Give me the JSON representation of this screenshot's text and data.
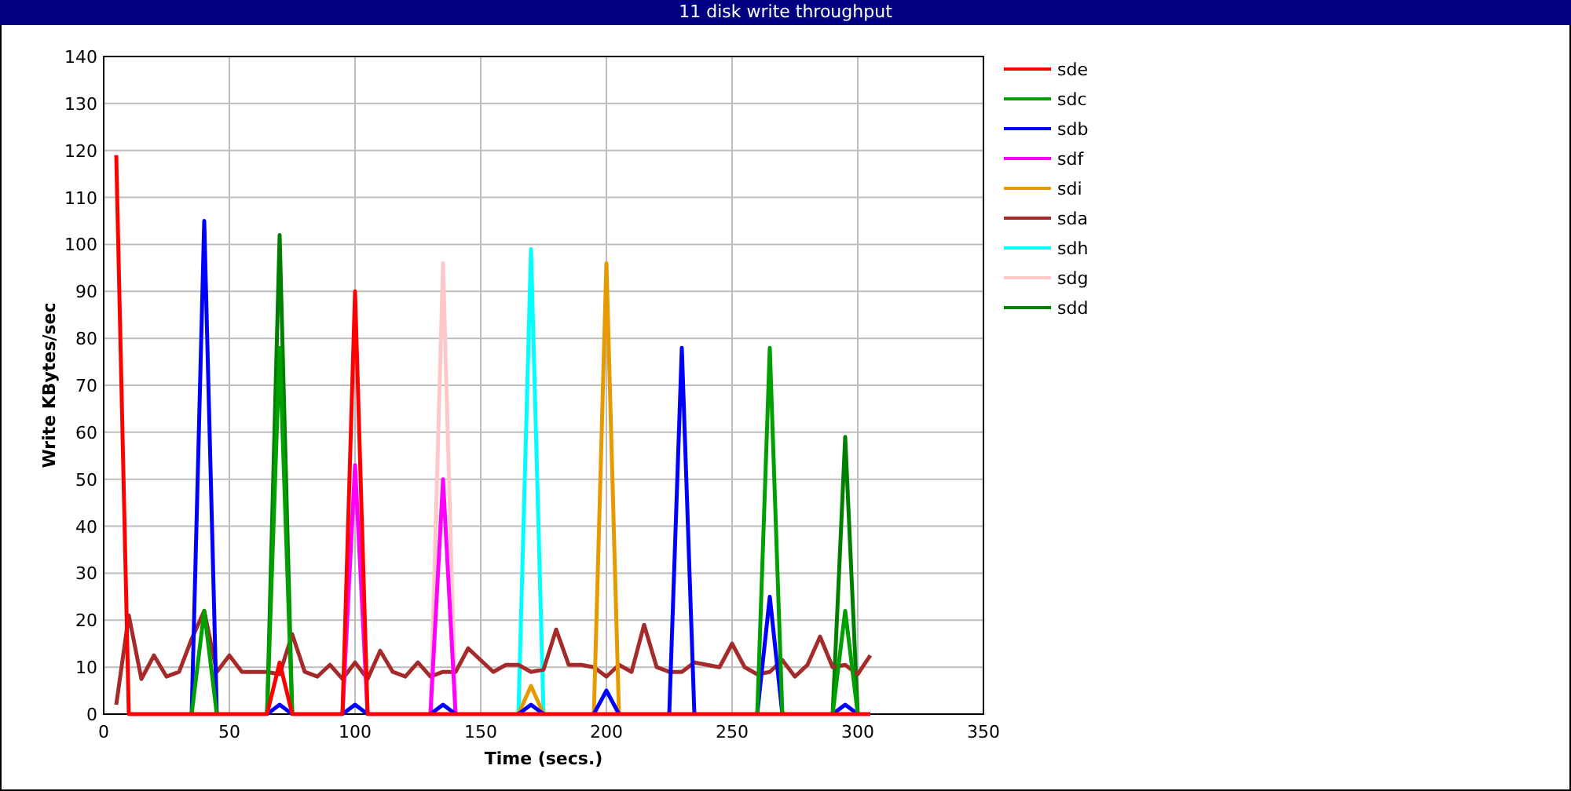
{
  "chart_data": {
    "type": "line",
    "title": "11 disk write throughput",
    "xlabel": "Time (secs.)",
    "ylabel": "Write KBytes/sec",
    "x": [
      5,
      10,
      15,
      20,
      25,
      30,
      35,
      40,
      45,
      50,
      55,
      60,
      65,
      70,
      75,
      80,
      85,
      90,
      95,
      100,
      105,
      110,
      115,
      120,
      125,
      130,
      135,
      140,
      145,
      150,
      155,
      160,
      165,
      170,
      175,
      180,
      185,
      190,
      195,
      200,
      205,
      210,
      215,
      220,
      225,
      230,
      235,
      240,
      245,
      250,
      255,
      260,
      265,
      270,
      275,
      280,
      285,
      290,
      295,
      300,
      305
    ],
    "xlim": [
      0,
      350
    ],
    "ylim": [
      0,
      140
    ],
    "grid": true,
    "legend": true,
    "xticks": [
      0,
      50,
      100,
      150,
      200,
      250,
      300,
      350
    ],
    "yticks": [
      0,
      10,
      20,
      30,
      40,
      50,
      60,
      70,
      80,
      90,
      100,
      110,
      120,
      130,
      140
    ],
    "series": [
      {
        "name": "sde",
        "color": "#ff0000",
        "values": [
          119,
          0,
          0,
          0,
          0,
          0,
          0,
          0,
          0,
          0,
          0,
          0,
          0,
          11,
          0,
          0,
          0,
          0,
          0,
          90,
          0,
          0,
          0,
          0,
          0,
          0,
          0,
          0,
          0,
          0,
          0,
          0,
          0,
          0,
          0,
          0,
          0,
          0,
          0,
          0,
          0,
          0,
          0,
          0,
          0,
          0,
          0,
          0,
          0,
          0,
          0,
          0,
          0,
          0,
          0,
          0,
          0,
          0,
          0,
          0,
          0
        ]
      },
      {
        "name": "sdc",
        "color": "#00a000",
        "values": [
          null,
          null,
          null,
          null,
          null,
          null,
          0,
          22,
          0,
          null,
          null,
          null,
          0,
          78,
          0,
          null,
          null,
          null,
          null,
          null,
          null,
          null,
          null,
          null,
          null,
          null,
          null,
          null,
          null,
          null,
          null,
          null,
          null,
          null,
          null,
          null,
          null,
          null,
          null,
          null,
          null,
          null,
          null,
          null,
          null,
          null,
          null,
          null,
          null,
          null,
          null,
          0,
          78,
          0,
          null,
          null,
          null,
          0,
          22,
          0,
          null
        ]
      },
      {
        "name": "sdb",
        "color": "#0000ff",
        "values": [
          null,
          null,
          null,
          null,
          null,
          null,
          0,
          105,
          0,
          null,
          null,
          null,
          0,
          2,
          0,
          null,
          null,
          null,
          0,
          2,
          0,
          null,
          null,
          null,
          null,
          0,
          2,
          0,
          null,
          null,
          null,
          null,
          0,
          2,
          0,
          null,
          null,
          null,
          0,
          5,
          0,
          null,
          null,
          null,
          0,
          78,
          0,
          null,
          null,
          null,
          null,
          0,
          25,
          0,
          null,
          null,
          null,
          0,
          2,
          0,
          null
        ]
      },
      {
        "name": "sdf",
        "color": "#ff00ff",
        "values": [
          null,
          null,
          null,
          null,
          null,
          null,
          null,
          null,
          null,
          null,
          null,
          null,
          null,
          null,
          null,
          null,
          null,
          null,
          0,
          53,
          0,
          null,
          null,
          null,
          null,
          0,
          50,
          0,
          null,
          null,
          null,
          null,
          null,
          null,
          null,
          null,
          null,
          null,
          null,
          null,
          null,
          null,
          null,
          null,
          null,
          null,
          null,
          null,
          null,
          null,
          null,
          null,
          null,
          null,
          null,
          null,
          null,
          null,
          null,
          null,
          null
        ]
      },
      {
        "name": "sdi",
        "color": "#e69a00",
        "values": [
          null,
          null,
          null,
          null,
          null,
          null,
          null,
          null,
          null,
          null,
          null,
          null,
          null,
          null,
          null,
          null,
          null,
          null,
          null,
          null,
          null,
          null,
          null,
          null,
          null,
          null,
          null,
          null,
          null,
          null,
          null,
          null,
          0,
          6,
          0,
          null,
          null,
          null,
          0,
          96,
          0,
          null,
          null,
          null,
          null,
          null,
          null,
          null,
          null,
          null,
          null,
          null,
          null,
          null,
          null,
          null,
          null,
          null,
          null,
          null,
          null
        ]
      },
      {
        "name": "sda",
        "color": "#a52a2a",
        "values": [
          2,
          21,
          7.5,
          12.5,
          8,
          9,
          16,
          22,
          9,
          12.5,
          9,
          9,
          9,
          8.5,
          17,
          9,
          8,
          10.5,
          7.5,
          11,
          7.5,
          13.5,
          9,
          8,
          11,
          8,
          9,
          9,
          14,
          11.5,
          9,
          10.5,
          10.5,
          9,
          9.5,
          18,
          10.5,
          10.5,
          10,
          8,
          10.5,
          9,
          19,
          10,
          9,
          9,
          11,
          10.5,
          10,
          15,
          10,
          8.5,
          9,
          11.5,
          8,
          10.5,
          16.5,
          10,
          10.5,
          8.5,
          12.5
        ]
      },
      {
        "name": "sdh",
        "color": "#00ffff",
        "values": [
          null,
          null,
          null,
          null,
          null,
          null,
          null,
          null,
          null,
          null,
          null,
          null,
          null,
          null,
          null,
          null,
          null,
          null,
          null,
          null,
          null,
          null,
          null,
          null,
          null,
          null,
          null,
          null,
          null,
          null,
          null,
          null,
          0,
          99,
          0,
          null,
          null,
          null,
          null,
          null,
          null,
          null,
          null,
          null,
          null,
          null,
          null,
          null,
          null,
          null,
          null,
          null,
          null,
          null,
          null,
          null,
          null,
          null,
          null,
          null,
          null
        ]
      },
      {
        "name": "sdg",
        "color": "#ffc8c8",
        "values": [
          null,
          null,
          null,
          null,
          null,
          null,
          null,
          null,
          null,
          null,
          null,
          null,
          null,
          null,
          null,
          null,
          null,
          null,
          null,
          null,
          null,
          null,
          null,
          null,
          null,
          0,
          96,
          0,
          null,
          null,
          null,
          null,
          null,
          null,
          null,
          null,
          null,
          null,
          null,
          null,
          null,
          null,
          null,
          null,
          null,
          null,
          null,
          null,
          null,
          null,
          null,
          null,
          null,
          null,
          null,
          null,
          null,
          null,
          null,
          null,
          null
        ]
      },
      {
        "name": "sdd",
        "color": "#008000",
        "values": [
          null,
          null,
          null,
          null,
          null,
          null,
          null,
          null,
          null,
          null,
          null,
          null,
          0,
          102,
          0,
          null,
          null,
          null,
          null,
          null,
          null,
          null,
          null,
          null,
          null,
          null,
          null,
          null,
          null,
          null,
          null,
          null,
          null,
          null,
          null,
          null,
          null,
          null,
          null,
          null,
          null,
          null,
          null,
          null,
          null,
          null,
          null,
          null,
          null,
          null,
          null,
          null,
          null,
          null,
          null,
          null,
          null,
          0,
          59,
          0,
          null
        ]
      }
    ]
  }
}
